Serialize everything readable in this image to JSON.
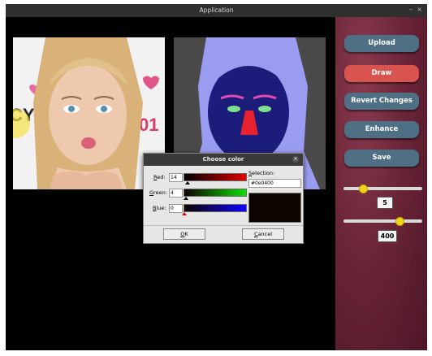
{
  "window": {
    "title": "Application",
    "minimize": "–",
    "close": "×"
  },
  "sidebar": {
    "buttons": [
      {
        "label": "Upload"
      },
      {
        "label": "Draw"
      },
      {
        "label": "Revert Changes"
      },
      {
        "label": "Enhance"
      },
      {
        "label": "Save"
      }
    ],
    "sliders": [
      {
        "value": "5",
        "fraction": 0.25
      },
      {
        "value": "400",
        "fraction": 0.72
      }
    ]
  },
  "dialog": {
    "title": "Choose color",
    "close": "×",
    "red_label": "Red:",
    "green_label": "Green:",
    "blue_label": "Blue:",
    "red_value": "14",
    "green_value": "4",
    "blue_value": "0",
    "selection_label": "Selection:",
    "selection_value": "#0e0400",
    "ok_label": "OK",
    "cancel_label": "Cancel"
  },
  "colors": {
    "selected": "#0e0400",
    "draw_button": "#d9534f",
    "button": "#4e6f84",
    "slider_knob": "#f2d31b"
  }
}
